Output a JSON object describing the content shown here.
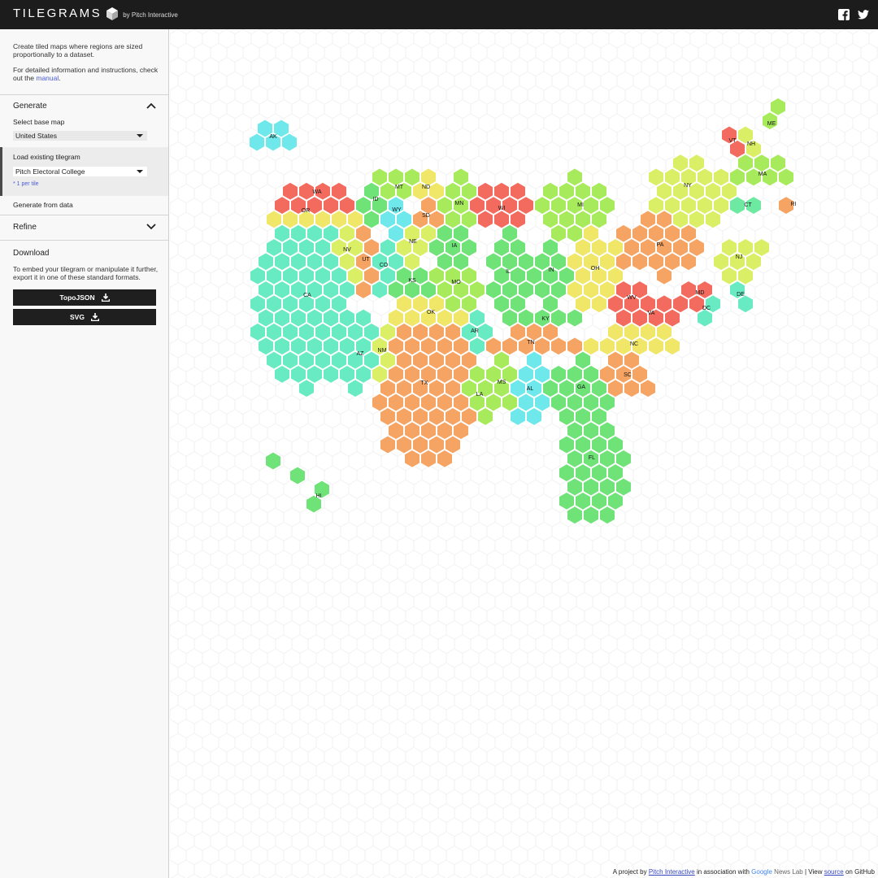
{
  "header": {
    "title": "TILEGRAMS",
    "byline": "by Pitch Interactive",
    "social": [
      "facebook-icon",
      "twitter-icon"
    ]
  },
  "sidebar": {
    "intro_line1": "Create tiled maps where regions are sized proportionally to a dataset.",
    "intro_line2_prefix": "For detailed information and instructions, check out the ",
    "intro_link": "manual",
    "intro_line2_suffix": ".",
    "generate": {
      "title": "Generate",
      "base_map_label": "Select base map",
      "base_map_value": "United States",
      "load_label": "Load existing tilegram",
      "load_value": "Pitch Electoral College",
      "load_note": "* 1 per tile",
      "from_data": "Generate from data"
    },
    "refine": {
      "title": "Refine"
    },
    "download": {
      "title": "Download",
      "description": "To embed your tilegram or manipulate it further, export it in one of these standard formats.",
      "topojson_label": "TopoJSON",
      "svg_label": "SVG"
    }
  },
  "map": {
    "colors": {
      "red": "#f26b5e",
      "orange": "#f5a463",
      "yellow": "#f0e668",
      "yellowgreen": "#dbef66",
      "lime": "#a7ea5c",
      "green": "#6fe278",
      "mint": "#6ee9a2",
      "teal": "#68ebc2",
      "cyan": "#6ee8ea"
    },
    "states": [
      {
        "label": "AK",
        "color": "cyan"
      },
      {
        "label": "HI",
        "color": "green"
      },
      {
        "label": "WA",
        "color": "red"
      },
      {
        "label": "OR",
        "color": "yellow"
      },
      {
        "label": "CA",
        "color": "teal"
      },
      {
        "label": "NV",
        "color": "yellowgreen"
      },
      {
        "label": "ID",
        "color": "green"
      },
      {
        "label": "MT",
        "color": "lime"
      },
      {
        "label": "WY",
        "color": "cyan"
      },
      {
        "label": "UT",
        "color": "orange"
      },
      {
        "label": "CO",
        "color": "teal"
      },
      {
        "label": "AZ",
        "color": "teal"
      },
      {
        "label": "NM",
        "color": "yellowgreen"
      },
      {
        "label": "ND",
        "color": "yellow"
      },
      {
        "label": "SD",
        "color": "orange"
      },
      {
        "label": "NE",
        "color": "yellowgreen"
      },
      {
        "label": "KS",
        "color": "green"
      },
      {
        "label": "OK",
        "color": "yellow"
      },
      {
        "label": "TX",
        "color": "orange"
      },
      {
        "label": "MN",
        "color": "lime"
      },
      {
        "label": "IA",
        "color": "green"
      },
      {
        "label": "MO",
        "color": "lime"
      },
      {
        "label": "AR",
        "color": "teal"
      },
      {
        "label": "LA",
        "color": "lime"
      },
      {
        "label": "WI",
        "color": "red"
      },
      {
        "label": "IL",
        "color": "green"
      },
      {
        "label": "MS",
        "color": "lime"
      },
      {
        "label": "MI",
        "color": "lime"
      },
      {
        "label": "IN",
        "color": "green"
      },
      {
        "label": "KY",
        "color": "green"
      },
      {
        "label": "TN",
        "color": "orange"
      },
      {
        "label": "AL",
        "color": "cyan"
      },
      {
        "label": "OH",
        "color": "yellow"
      },
      {
        "label": "GA",
        "color": "green"
      },
      {
        "label": "FL",
        "color": "green"
      },
      {
        "label": "SC",
        "color": "orange"
      },
      {
        "label": "NC",
        "color": "yellow"
      },
      {
        "label": "VA",
        "color": "red"
      },
      {
        "label": "WV",
        "color": "red"
      },
      {
        "label": "PA",
        "color": "orange"
      },
      {
        "label": "NY",
        "color": "yellowgreen"
      },
      {
        "label": "VT",
        "color": "red"
      },
      {
        "label": "NH",
        "color": "yellowgreen"
      },
      {
        "label": "ME",
        "color": "lime"
      },
      {
        "label": "MA",
        "color": "lime"
      },
      {
        "label": "CT",
        "color": "mint"
      },
      {
        "label": "RI",
        "color": "orange"
      },
      {
        "label": "NJ",
        "color": "yellowgreen"
      },
      {
        "label": "DE",
        "color": "teal"
      },
      {
        "label": "MD",
        "color": "red"
      },
      {
        "label": "DC",
        "color": "teal"
      }
    ]
  },
  "footer": {
    "prefix": "A project by",
    "pitch": "Pitch Interactive",
    "middle": "in association with",
    "google": "Google",
    "news_lab": "News Lab",
    "view": "| View",
    "source": "source",
    "suffix": "on GitHub"
  }
}
